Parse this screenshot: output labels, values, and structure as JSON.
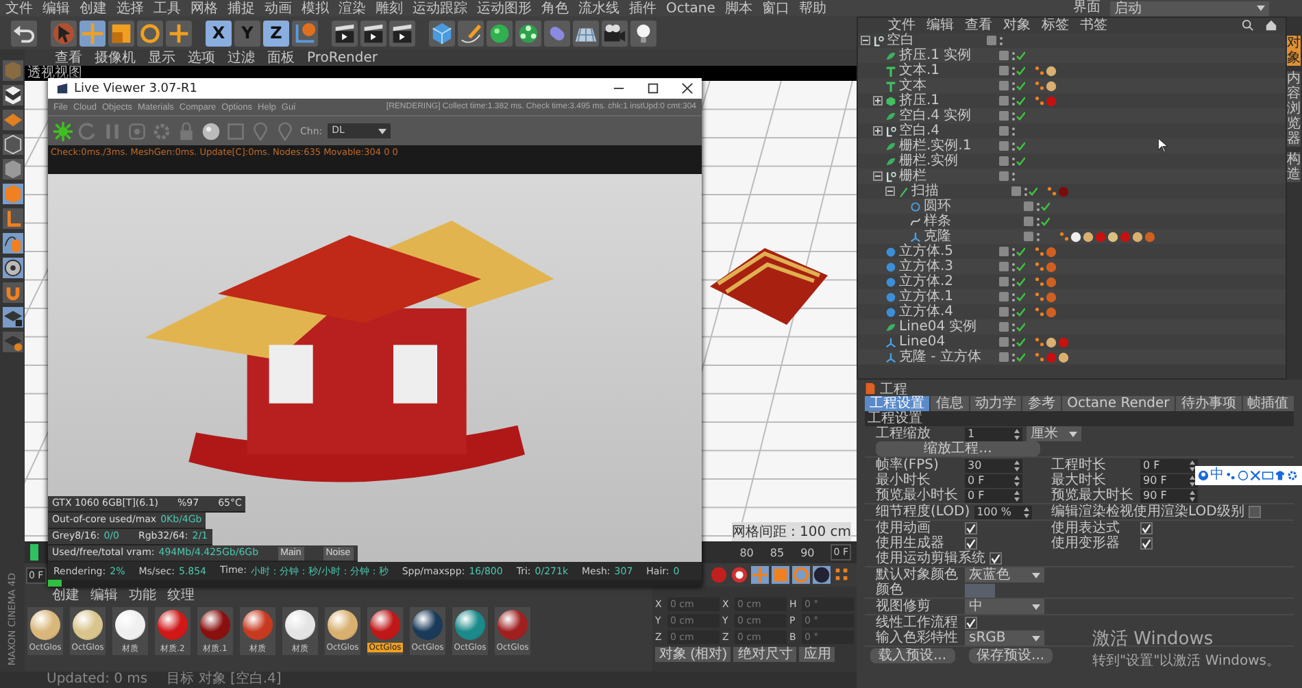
{
  "menu_bar": {
    "items": [
      "文件",
      "编辑",
      "创建",
      "选择",
      "工具",
      "网格",
      "捕捉",
      "动画",
      "模拟",
      "渲染",
      "雕刻",
      "运动跟踪",
      "运动图形",
      "角色",
      "流水线",
      "插件",
      "Octane",
      "脚本",
      "窗口",
      "帮助"
    ],
    "layout_label": "界面",
    "layout_value": "启动"
  },
  "axis_buttons": [
    {
      "label": "X",
      "selected": true
    },
    {
      "label": "Y",
      "selected": false
    },
    {
      "label": "Z",
      "selected": true
    }
  ],
  "viewport": {
    "menu": [
      "查看",
      "摄像机",
      "显示",
      "选项",
      "过滤",
      "面板",
      "ProRender"
    ],
    "title": "透视视图",
    "grid_spacing": "网格间距 : 100 cm"
  },
  "live_viewer": {
    "title": "Live Viewer 3.07-R1",
    "menu": [
      "File",
      "Cloud",
      "Objects",
      "Materials",
      "Compare",
      "Options",
      "Help",
      "Gui"
    ],
    "status": "[RENDERING] Collect time:1.382 ms. Check time:3.495 ms. chk:1 instUpd:0 cmt:304",
    "channel_label": "Chn:",
    "channel": "DL",
    "log": "Check:0ms./3ms. MeshGen:0ms. Update[C]:0ms. Nodes:635 Movable:304 0 0",
    "gpu": {
      "name": "GTX 1060 6GB[T](6.1)",
      "usage": "%97",
      "temp": "65°C"
    },
    "memory": [
      {
        "pairs": [
          {
            "label": "Out-of-core used/max",
            "value": "0Kb/4Gb"
          }
        ]
      },
      {
        "pairs": [
          {
            "label": "Grey8/16:",
            "value": "0/0"
          },
          {
            "label": "Rgb32/64:",
            "value": "2/1"
          }
        ]
      },
      {
        "pairs": [
          {
            "label": "Used/free/total vram:",
            "value": "494Mb/4.425Gb/6Gb"
          }
        ]
      }
    ],
    "view_buttons": [
      "Main",
      "Noise"
    ],
    "render_stats": [
      {
        "label": "Rendering:",
        "value": "2%"
      },
      {
        "label": "Ms/sec:",
        "value": "5.854"
      },
      {
        "label": "Time:",
        "value": "小时：分钟：秒/小时：分钟：秒"
      },
      {
        "label": "Spp/maxspp:",
        "value": "16/800"
      },
      {
        "label": "Tri:",
        "value": "0/271k"
      },
      {
        "label": "Mesh:",
        "value": "307"
      },
      {
        "label": "Hair:",
        "value": "0"
      }
    ],
    "progress": {
      "level": 0.02
    }
  },
  "timeline": {
    "ticks": [
      "80",
      "85",
      "90"
    ],
    "end_frame": "0 F",
    "start_frame": "0 F"
  },
  "material_manager": {
    "menu": [
      "创建",
      "编辑",
      "功能",
      "纹理"
    ],
    "materials": [
      {
        "name": "OctGlos",
        "color": "#d9b77a",
        "selected": false
      },
      {
        "name": "OctGlos",
        "color": "#d8c48c",
        "selected": false
      },
      {
        "name": "材质",
        "color": "#efefef",
        "selected": false
      },
      {
        "name": "材质.2",
        "color": "#d01818",
        "selected": false
      },
      {
        "name": "材质.1",
        "color": "#8a1010",
        "selected": false
      },
      {
        "name": "材质",
        "color": "#c83a20",
        "selected": false
      },
      {
        "name": "材质",
        "color": "#e4e4e4",
        "selected": false
      },
      {
        "name": "OctGlos",
        "color": "#d9b070",
        "selected": false
      },
      {
        "name": "OctGlos",
        "color": "#c01818",
        "selected": true
      },
      {
        "name": "OctGlos",
        "color": "#1a3a5a",
        "selected": false
      },
      {
        "name": "OctGlos",
        "color": "#1a8a8a",
        "selected": false
      },
      {
        "name": "OctGlos",
        "color": "#a02020",
        "selected": false
      }
    ]
  },
  "coordinates": {
    "rows": [
      {
        "axes": [
          "X",
          "X",
          "H"
        ],
        "values": [
          "0 cm",
          "0 cm",
          "0 °"
        ]
      },
      {
        "axes": [
          "Y",
          "Y",
          "P"
        ],
        "values": [
          "0 cm",
          "0 cm",
          "0 °"
        ]
      },
      {
        "axes": [
          "Z",
          "Z",
          "B"
        ],
        "values": [
          "0 cm",
          "0 cm",
          "0 °"
        ]
      }
    ],
    "buttons": [
      "对象 (相对)",
      "绝对尺寸",
      "应用"
    ]
  },
  "status_bar": {
    "left": "Updated: 0 ms",
    "right": "目标 对象 [空白.4]"
  },
  "object_manager": {
    "menu": [
      "文件",
      "编辑",
      "查看",
      "对象",
      "标签",
      "书签"
    ],
    "items": [
      {
        "name": "空白",
        "kind": "null",
        "checked": false,
        "expanded": true,
        "children": [
          {
            "name": "挤压.1 实例",
            "kind": "instance",
            "checked": true
          },
          {
            "name": "文本.1",
            "kind": "text",
            "checked": true,
            "tags": [
              {
                "color": "#d9b070"
              }
            ]
          },
          {
            "name": "文本",
            "kind": "text",
            "checked": true,
            "tags": [
              {
                "color": "#d9b070"
              }
            ]
          },
          {
            "name": "挤压.1",
            "kind": "extrude",
            "checked": true,
            "expanded": false,
            "tags": [
              {
                "color": "#c81010"
              }
            ]
          },
          {
            "name": "空白.4 实例",
            "kind": "instance",
            "checked": true
          },
          {
            "name": "空白.4",
            "kind": "null",
            "checked": false,
            "expanded": false
          },
          {
            "name": "栅栏.实例.1",
            "kind": "instance",
            "checked": true
          },
          {
            "name": "栅栏.实例",
            "kind": "instance",
            "checked": true
          },
          {
            "name": "栅栏",
            "kind": "null",
            "checked": false,
            "expanded": true,
            "children": [
              {
                "name": "扫描",
                "kind": "sweep",
                "checked": true,
                "expanded": true,
                "tags": [
                  {
                    "color": "#7a0c0c"
                  }
                ],
                "children": [
                  {
                    "name": "圆环",
                    "kind": "circle",
                    "checked": true
                  },
                  {
                    "name": "样条",
                    "kind": "spline",
                    "checked": true
                  },
                  {
                    "name": "克隆",
                    "kind": "cloner",
                    "checked": false,
                    "tags": [
                      {
                        "color": "#eeeeee"
                      },
                      {
                        "color": "#d9b070"
                      },
                      {
                        "color": "#c81010"
                      },
                      {
                        "color": "#d8c080"
                      },
                      {
                        "color": "#c81010"
                      },
                      {
                        "color": "#d9b070"
                      },
                      {
                        "color": "#d06020"
                      }
                    ]
                  }
                ]
              }
            ]
          },
          {
            "name": "立方体.5",
            "kind": "cube",
            "checked": true,
            "tags": [
              {
                "color": "#d06020"
              }
            ]
          },
          {
            "name": "立方体.3",
            "kind": "cube",
            "checked": true,
            "tags": [
              {
                "color": "#d06020"
              }
            ]
          },
          {
            "name": "立方体.2",
            "kind": "cube",
            "checked": true,
            "tags": [
              {
                "color": "#d06020"
              }
            ]
          },
          {
            "name": "立方体.1",
            "kind": "cube",
            "checked": true,
            "tags": [
              {
                "color": "#d06020"
              }
            ]
          },
          {
            "name": "立方体.4",
            "kind": "cube",
            "checked": true,
            "tags": [
              {
                "color": "#d06020"
              }
            ]
          },
          {
            "name": "Line04 实例",
            "kind": "instance",
            "checked": true
          },
          {
            "name": "Line04",
            "kind": "cloner",
            "checked": true,
            "tags": [
              {
                "color": "#d9b070"
              },
              {
                "color": "#c81010"
              }
            ]
          },
          {
            "name": "克隆 - 立方体",
            "kind": "cloner",
            "checked": true,
            "tags": [
              {
                "color": "#c81010"
              },
              {
                "color": "#d9b070"
              }
            ]
          }
        ]
      }
    ]
  },
  "side_tabs": [
    {
      "label": "对象",
      "selected": true
    },
    {
      "label": "内容浏览器",
      "selected": false
    },
    {
      "label": "构造",
      "selected": false
    }
  ],
  "attributes": {
    "title": "工程",
    "tabs": [
      {
        "label": "工程设置",
        "selected": true
      },
      {
        "label": "信息",
        "selected": false
      },
      {
        "label": "动力学",
        "selected": false
      },
      {
        "label": "参考",
        "selected": false
      },
      {
        "label": "Octane Render",
        "selected": false
      },
      {
        "label": "待办事项",
        "selected": false
      },
      {
        "label": "帧插值",
        "selected": false
      }
    ],
    "section": "工程设置",
    "groups": [
      {
        "rows": [
          {
            "fields": [
              {
                "kind": "number",
                "label": "工程缩放",
                "value": "1",
                "unit": "厘米"
              }
            ]
          },
          {
            "fields": [
              {
                "kind": "button",
                "label": "缩放工程..."
              }
            ]
          }
        ]
      },
      {
        "rows": [
          {
            "fields": [
              {
                "kind": "number",
                "label": "帧率(FPS)",
                "value": "30"
              },
              {
                "kind": "number",
                "label": "工程时长",
                "value": "0 F"
              }
            ]
          },
          {
            "fields": [
              {
                "kind": "number",
                "label": "最小时长",
                "value": "0 F"
              },
              {
                "kind": "number",
                "label": "最大时长",
                "value": "90 F"
              }
            ]
          },
          {
            "fields": [
              {
                "kind": "number",
                "label": "预览最小时长",
                "value": "0 F"
              },
              {
                "kind": "number",
                "label": "预览最大时长",
                "value": "90 F"
              }
            ]
          }
        ]
      },
      {
        "rows": [
          {
            "fields": [
              {
                "kind": "number",
                "label": "细节程度(LOD)",
                "value": "100 %"
              },
              {
                "kind": "checkbox",
                "label": "编辑渲染检视使用渲染LOD级别",
                "checked": false
              }
            ]
          }
        ]
      },
      {
        "rows": [
          {
            "fields": [
              {
                "kind": "checkbox",
                "label": "使用动画",
                "checked": true
              },
              {
                "kind": "checkbox",
                "label": "使用表达式",
                "checked": true
              }
            ]
          },
          {
            "fields": [
              {
                "kind": "checkbox",
                "label": "使用生成器",
                "checked": true
              },
              {
                "kind": "checkbox",
                "label": "使用变形器",
                "checked": true
              }
            ]
          },
          {
            "fields": [
              {
                "kind": "checkbox",
                "label": "使用运动剪辑系统",
                "checked": true
              }
            ]
          }
        ]
      },
      {
        "rows": [
          {
            "fields": [
              {
                "kind": "dropdown",
                "label": "默认对象颜色",
                "value": "灰蓝色"
              }
            ]
          },
          {
            "fields": [
              {
                "kind": "color",
                "label": "颜色",
                "color": "#59606c"
              }
            ]
          }
        ]
      },
      {
        "rows": [
          {
            "fields": [
              {
                "kind": "dropdown",
                "label": "视图修剪",
                "value": "中"
              }
            ]
          }
        ]
      },
      {
        "rows": [
          {
            "fields": [
              {
                "kind": "checkbox",
                "label": "线性工作流程",
                "checked": true
              }
            ]
          },
          {
            "fields": [
              {
                "kind": "dropdown",
                "label": "输入色彩特性",
                "value": "sRGB"
              }
            ]
          }
        ]
      }
    ],
    "buttons": [
      "载入预设...",
      "保存预设..."
    ]
  },
  "ime_bar": {
    "label": "中"
  },
  "activation": {
    "title": "激活 Windows",
    "hint": "转到\"设置\"以激活 Windows。"
  },
  "brand": "MAXON CINEMA 4D"
}
